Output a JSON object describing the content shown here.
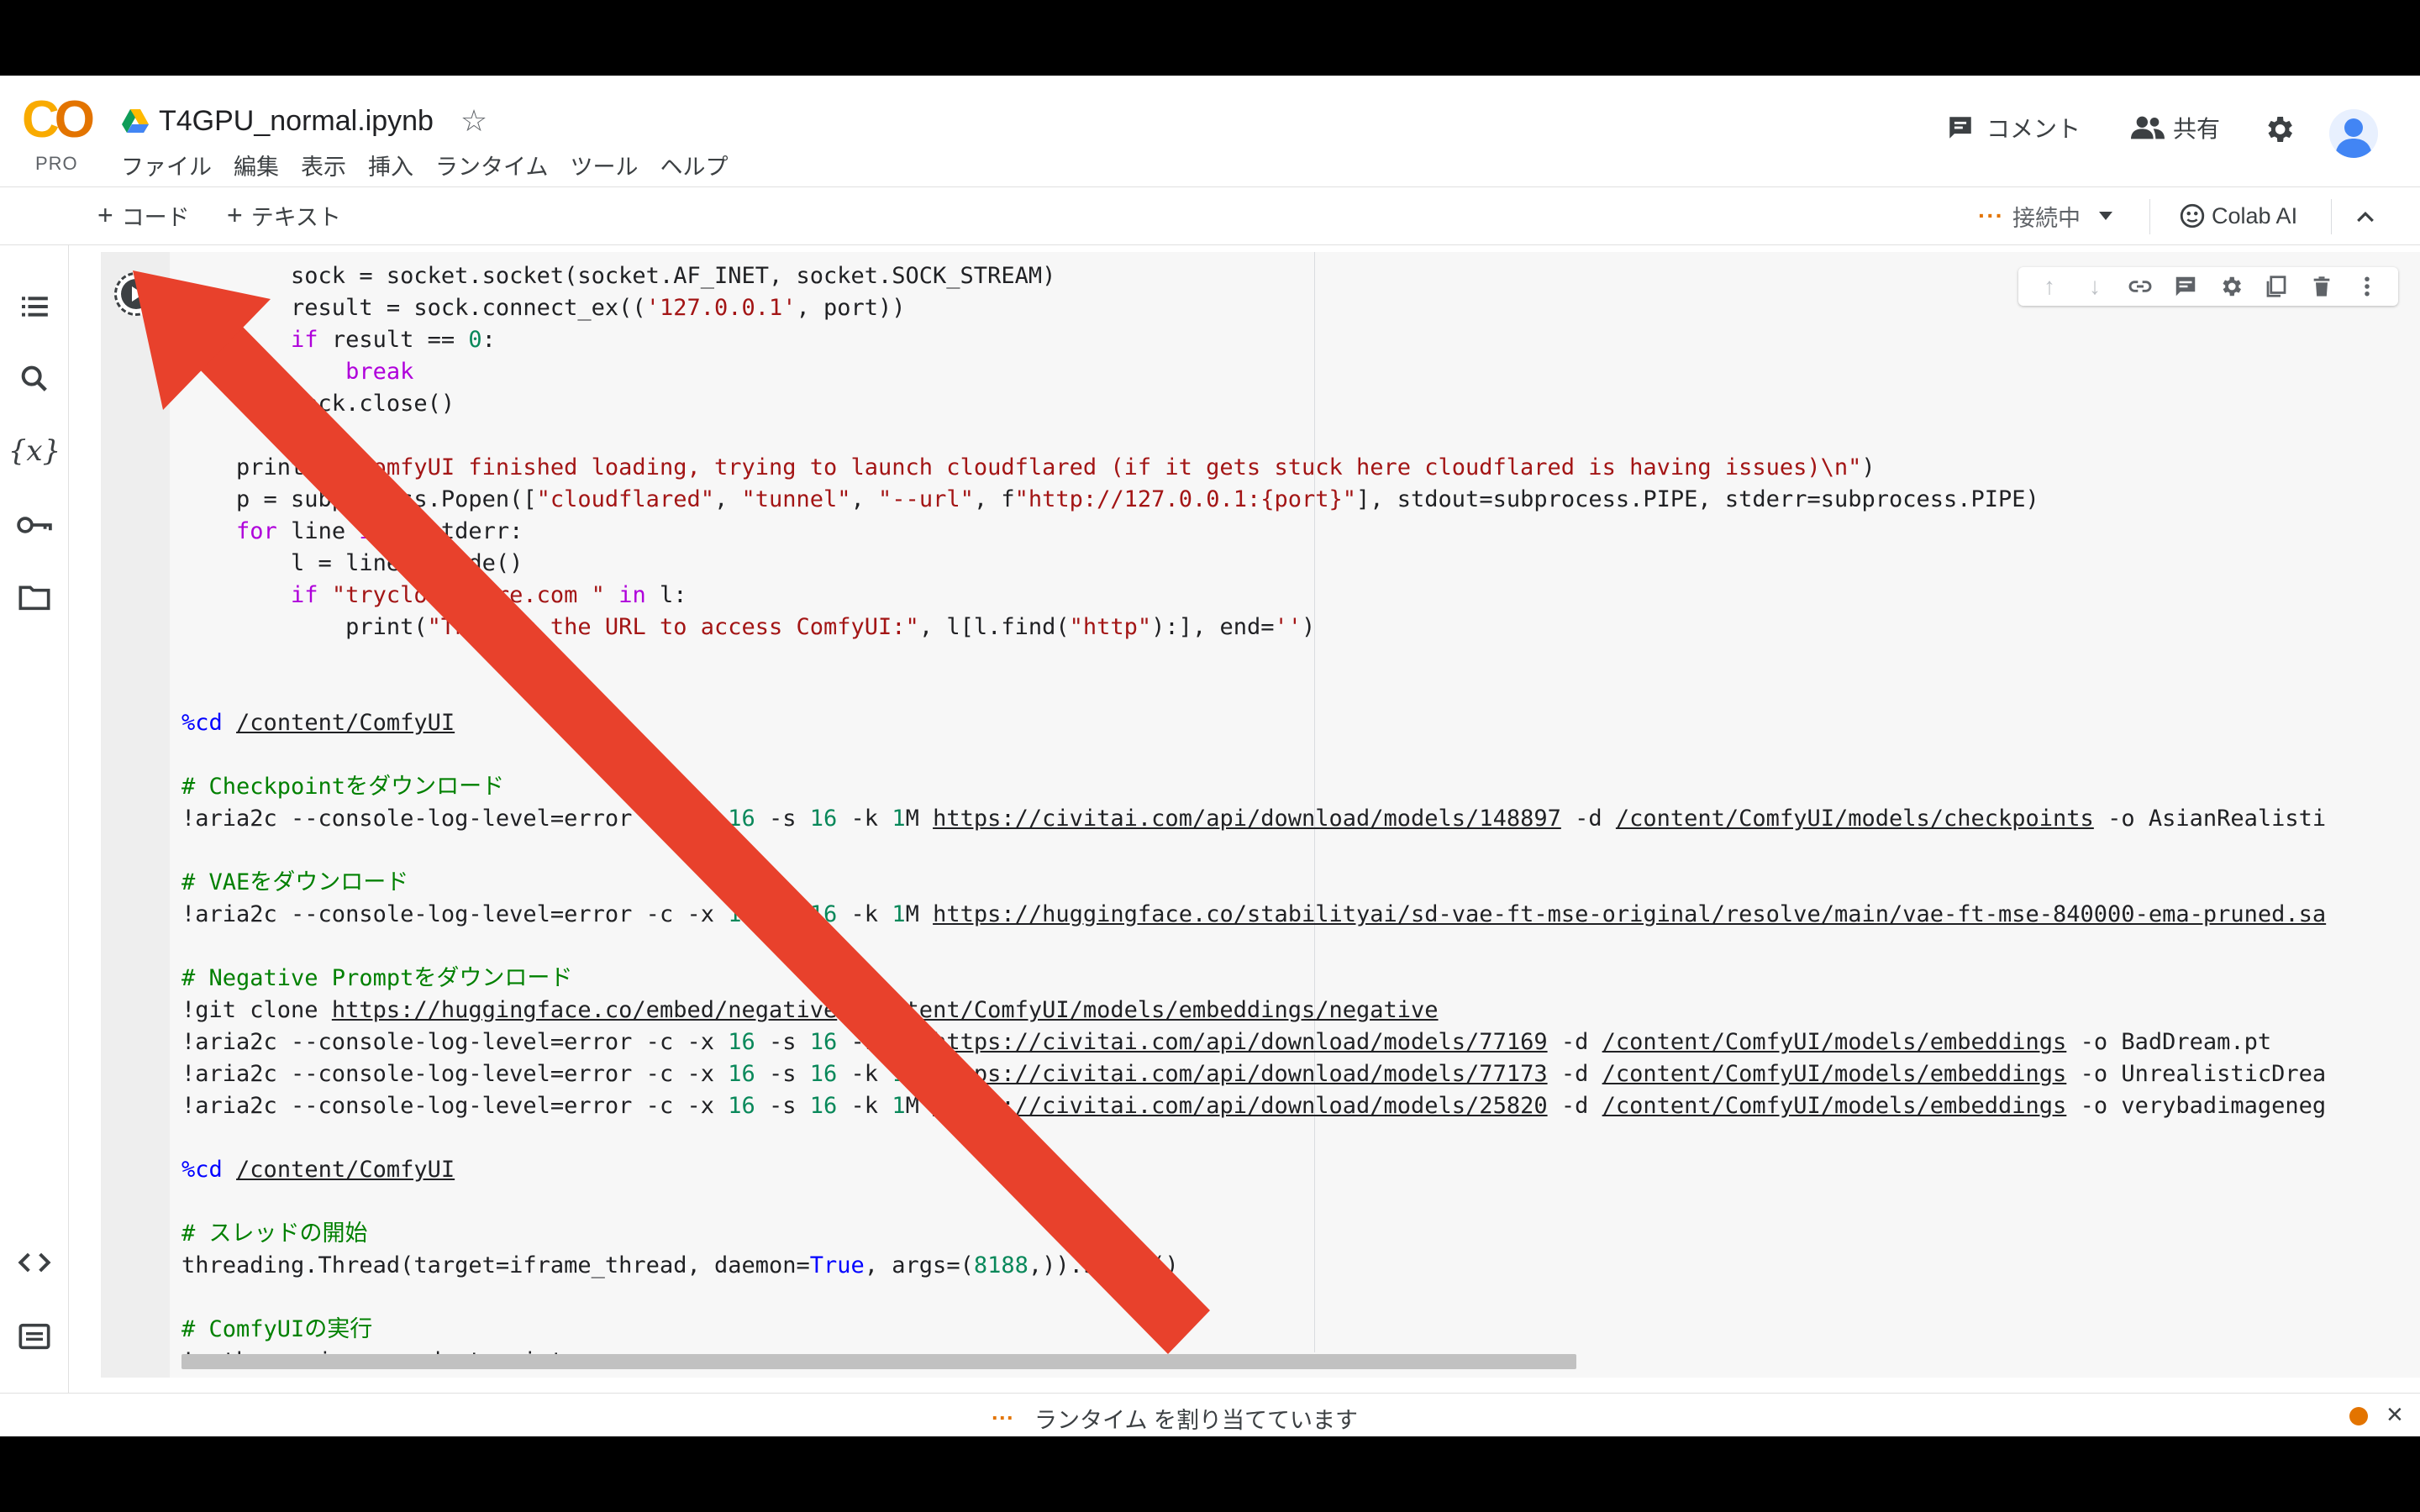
{
  "header": {
    "logo_text": "CO",
    "logo_badge": "PRO",
    "notebook_title": "T4GPU_normal.ipynb",
    "comment_label": "コメント",
    "share_label": "共有"
  },
  "menu": [
    "ファイル",
    "編集",
    "表示",
    "挿入",
    "ランタイム",
    "ツール",
    "ヘルプ"
  ],
  "toolbar": {
    "add_code": "コード",
    "add_text": "テキスト",
    "connection_status": "接続中",
    "colab_ai": "Colab AI"
  },
  "code_lines": [
    "        sock = socket.socket(socket.AF_INET, socket.SOCK_STREAM)",
    "        result = sock.connect_ex(('127.0.0.1', port))",
    "        if result == 0:",
    "            break",
    "        sock.close()",
    "",
    "    print(\"\\nComfyUI finished loading, trying to launch cloudflared (if it gets stuck here cloudflared is having issues)\\n\")",
    "    p = subprocess.Popen([\"cloudflared\", \"tunnel\", \"--url\", f\"http://127.0.0.1:{port}\"], stdout=subprocess.PIPE, stderr=subprocess.PIPE)",
    "    for line in p.stderr:",
    "        l = line.decode()",
    "        if \"trycloudflare.com \" in l:",
    "            print(\"This is the URL to access ComfyUI:\", l[l.find(\"http\"):], end='')",
    "",
    "",
    "%cd /content/ComfyUI",
    "",
    "# Checkpointをダウンロード",
    "!aria2c --console-log-level=error -c -x 16 -s 16 -k 1M https://civitai.com/api/download/models/148897 -d /content/ComfyUI/models/checkpoints -o AsianRealisti",
    "",
    "# VAEをダウンロード",
    "!aria2c --console-log-level=error -c -x 16 -s 16 -k 1M https://huggingface.co/stabilityai/sd-vae-ft-mse-original/resolve/main/vae-ft-mse-840000-ema-pruned.sa",
    "",
    "# Negative Promptをダウンロード",
    "!git clone https://huggingface.co/embed/negative /content/ComfyUI/models/embeddings/negative",
    "!aria2c --console-log-level=error -c -x 16 -s 16 -k 1M https://civitai.com/api/download/models/77169 -d /content/ComfyUI/models/embeddings -o BadDream.pt",
    "!aria2c --console-log-level=error -c -x 16 -s 16 -k 1M https://civitai.com/api/download/models/77173 -d /content/ComfyUI/models/embeddings -o UnrealisticDrea",
    "!aria2c --console-log-level=error -c -x 16 -s 16 -k 1M https://civitai.com/api/download/models/25820 -d /content/ComfyUI/models/embeddings -o verybadimageneg",
    "",
    "%cd /content/ComfyUI",
    "",
    "# スレッドの開始",
    "threading.Thread(target=iframe_thread, daemon=True, args=(8188,)).start()",
    "",
    "# ComfyUIの実行",
    "!python main.py --dont-print-server"
  ],
  "status": {
    "message": "ランタイム を割り当てています"
  },
  "colors": {
    "accent_orange": "#e37400",
    "arrow_red": "#e8412c",
    "comment_green": "#008000"
  },
  "icons": {
    "sidebar": [
      "toc-icon",
      "search-icon",
      "variables-icon",
      "secrets-key-icon",
      "files-folder-icon",
      "code-snippets-icon",
      "command-palette-icon",
      "terminal-icon"
    ],
    "cell_toolbar": [
      "move-up-icon",
      "move-down-icon",
      "link-icon",
      "comment-icon",
      "settings-icon",
      "mirror-cell-icon",
      "delete-icon",
      "more-vert-icon"
    ]
  }
}
